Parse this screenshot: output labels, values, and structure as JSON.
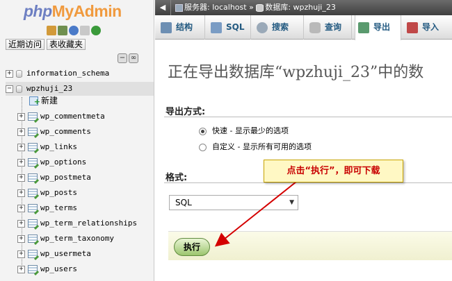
{
  "nav": {
    "logo_php": "php",
    "logo_myadmin": "MyAdmin",
    "icons": [
      "home-icon",
      "exit-icon",
      "help-icon",
      "docs-icon",
      "reload-icon"
    ],
    "links": [
      "近期访问",
      "表收藏夹"
    ],
    "collapse_label": "−",
    "link_label": "∞",
    "databases": [
      {
        "name": "information_schema",
        "expander": "+"
      },
      {
        "name": "wpzhuji_23",
        "expander": "−"
      }
    ],
    "new_label": "新建",
    "tables": [
      "wp_commentmeta",
      "wp_comments",
      "wp_links",
      "wp_options",
      "wp_postmeta",
      "wp_posts",
      "wp_terms",
      "wp_term_relationships",
      "wp_term_taxonomy",
      "wp_usermeta",
      "wp_users"
    ]
  },
  "breadcrumb": {
    "back": "◀",
    "server": "服务器: localhost",
    "sep": "»",
    "database": "数据库: wpzhuji_23"
  },
  "tabs": [
    {
      "label": "结构",
      "icon": "structure-icon",
      "color": "#6d8fb3"
    },
    {
      "label": "SQL",
      "icon": "sql-icon",
      "color": "#7a9cc4"
    },
    {
      "label": "搜索",
      "icon": "search-icon",
      "color": "#9aa9b8"
    },
    {
      "label": "查询",
      "icon": "query-icon",
      "color": "#b9b9b9"
    },
    {
      "label": "导出",
      "icon": "export-icon",
      "color": "#5a9a6e"
    },
    {
      "label": "导入",
      "icon": "import-icon",
      "color": "#c04848"
    }
  ],
  "active_tab": "导出",
  "main": {
    "title": "正在导出数据库“wpzhuji_23”中的数",
    "method_heading": "导出方式:",
    "method_options": [
      {
        "label": "快速 - 显示最少的选项",
        "checked": true
      },
      {
        "label": "自定义 - 显示所有可用的选项",
        "checked": false
      }
    ],
    "format_heading": "格式:",
    "format_value": "SQL",
    "select_arrow": "▼",
    "go_label": "执行"
  },
  "annotation": {
    "text": "点击“执行”，即可下载",
    "color": "#d40000"
  }
}
